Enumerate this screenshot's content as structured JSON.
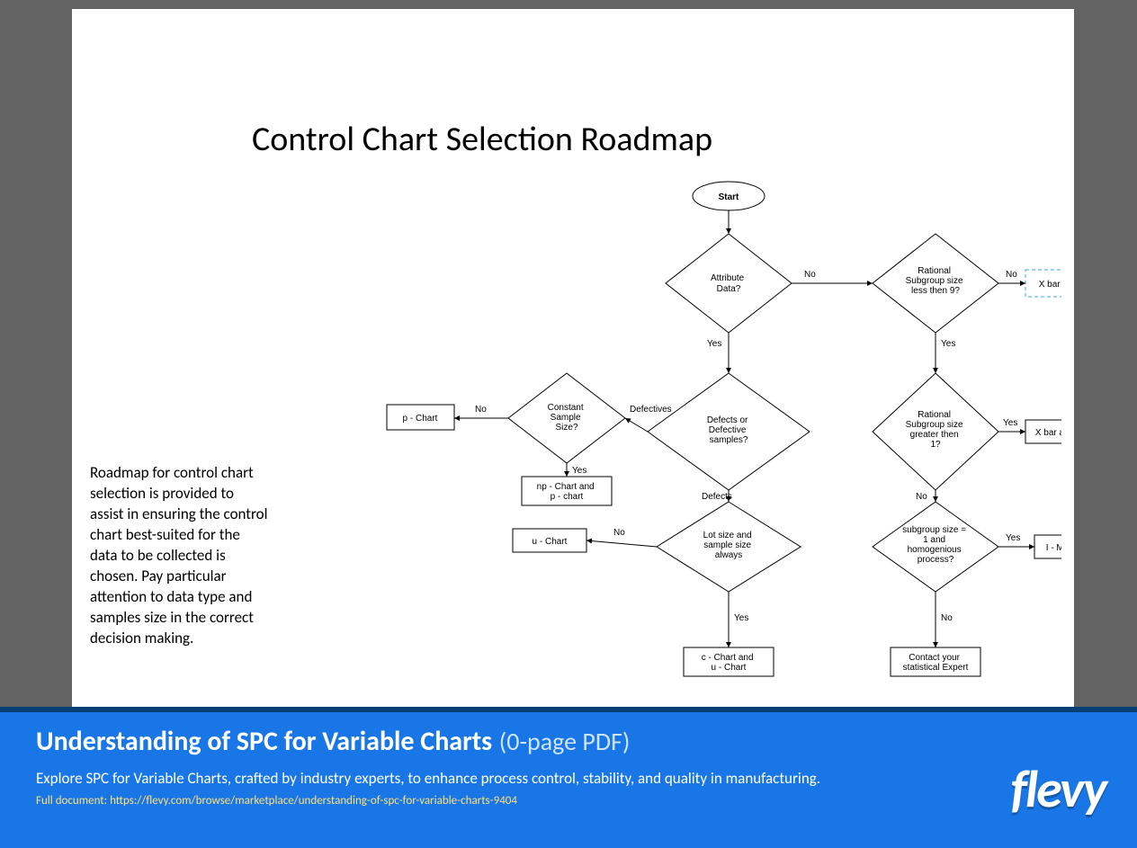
{
  "slide": {
    "title": "Control Chart Selection Roadmap",
    "description": "Roadmap for control chart selection is provided to assist in ensuring the control chart best-suited for the data to be collected is chosen. Pay particular attention to data type and samples size in the correct decision making."
  },
  "flow": {
    "nodes": {
      "start": "Start",
      "attribute": "Attribute Data?",
      "subgroup_lt9": "Rational Subgroup size less then 9?",
      "xbar_s": "X bar S Chart",
      "constant_sample": "Constant Sample Size?",
      "p_chart": "p - Chart",
      "np_p_chart": "np - Chart and p - chart",
      "defects_or_defective": "Defects or Defective samples?",
      "subgroup_gt1": "Rational Subgroup size greater then 1?",
      "xbar_r": "X bar and R chart",
      "u_chart": "u - Chart",
      "lot_sample_always": "Lot size and sample size always",
      "subgroup1_homog": "subgroup size = 1 and homogenious process?",
      "i_mr": "I - MR Chart",
      "c_u_chart": "c - Chart and u - Chart",
      "contact_expert": "Contact your statistical Expert"
    },
    "edges": {
      "no": "No",
      "yes": "Yes",
      "defectives": "Defectives",
      "defects": "Defects"
    }
  },
  "footer": {
    "title": "Understanding of SPC for Variable Charts",
    "meta": "(0-page PDF)",
    "description": "Explore SPC for Variable Charts, crafted by industry experts, to enhance process control, stability, and quality in manufacturing.",
    "link_prefix": "Full document: ",
    "link": "https://flevy.com/browse/marketplace/understanding-of-spc-for-variable-charts-9404",
    "logo": "flevy"
  }
}
